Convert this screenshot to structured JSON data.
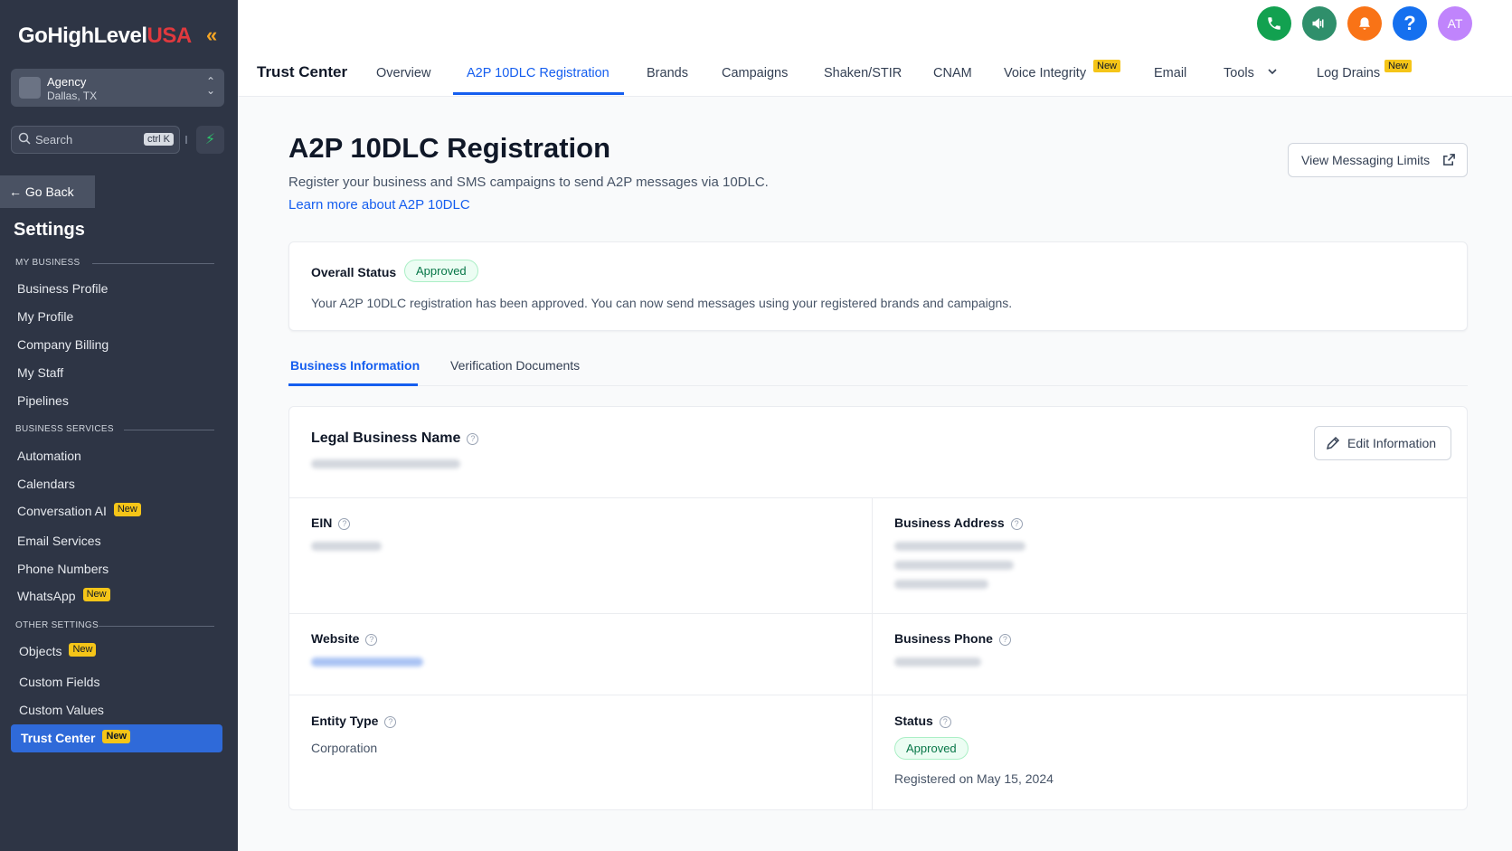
{
  "sidebar": {
    "logo_main": "GoHighLevel",
    "logo_suffix": "USA",
    "agency_name": "Agency",
    "agency_location": "Dallas, TX",
    "search_placeholder": "Search",
    "search_shortcut": "ctrl K",
    "go_back": "Go Back",
    "settings_title": "Settings",
    "sections": {
      "my_business": "MY BUSINESS",
      "business_services": "BUSINESS SERVICES",
      "other_settings": "OTHER SETTINGS"
    },
    "items": {
      "business_profile": "Business Profile",
      "my_profile": "My Profile",
      "company_billing": "Company Billing",
      "my_staff": "My Staff",
      "pipelines": "Pipelines",
      "automation": "Automation",
      "calendars": "Calendars",
      "conversation_ai": "Conversation AI",
      "email_services": "Email Services",
      "phone_numbers": "Phone Numbers",
      "whatsapp": "WhatsApp",
      "objects": "Objects",
      "custom_fields": "Custom Fields",
      "custom_values": "Custom Values",
      "trust_center": "Trust Center"
    },
    "new_badge": "New"
  },
  "header": {
    "title": "Trust Center",
    "tabs": {
      "overview": "Overview",
      "a2p": "A2P 10DLC Registration",
      "brands": "Brands",
      "campaigns": "Campaigns",
      "shaken": "Shaken/STIR",
      "cnam": "CNAM",
      "voice_integrity": "Voice Integrity",
      "email": "Email",
      "tools": "Tools",
      "log_drains": "Log Drains"
    },
    "new_badge": "New",
    "avatar_initials": "AT",
    "help_glyph": "?",
    "colors": {
      "phone": "#12a150",
      "megaphone": "#2f8f6b",
      "bell": "#f97316",
      "help": "#1570ef",
      "avatar": "#c084fc"
    }
  },
  "main": {
    "title": "A2P 10DLC Registration",
    "subtitle": "Register your business and SMS campaigns to send A2P messages via 10DLC.",
    "learn_more": "Learn more about A2P 10DLC",
    "view_limits": "View Messaging Limits",
    "overall_status_label": "Overall Status",
    "overall_status_value": "Approved",
    "overall_status_message": "Your A2P 10DLC registration has been approved. You can now send messages using your registered brands and campaigns.",
    "subtabs": {
      "business_info": "Business Information",
      "verification_docs": "Verification Documents"
    },
    "fields": {
      "legal_name_label": "Legal Business Name",
      "edit_button": "Edit Information",
      "ein_label": "EIN",
      "address_label": "Business Address",
      "website_label": "Website",
      "phone_label": "Business Phone",
      "entity_type_label": "Entity Type",
      "entity_type_value": "Corporation",
      "status_label": "Status",
      "status_value": "Approved",
      "registered_on": "Registered on May 15, 2024"
    }
  }
}
